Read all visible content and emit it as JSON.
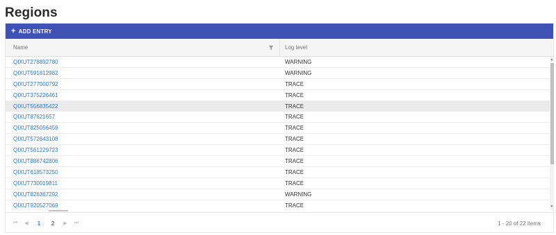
{
  "page": {
    "title": "Regions"
  },
  "toolbar": {
    "add_label": "ADD ENTRY"
  },
  "columns": {
    "name": "Name",
    "level": "Log level"
  },
  "rows": [
    {
      "name": "QIXUT278892780",
      "level": "WARNING"
    },
    {
      "name": "QIXUT591812982",
      "level": "WARNING"
    },
    {
      "name": "QIXUT277000792",
      "level": "TRACE"
    },
    {
      "name": "QIXUT375226461",
      "level": "TRACE"
    },
    {
      "name": "QIXUT556835422",
      "level": "TRACE"
    },
    {
      "name": "QIXUT87621657",
      "level": "TRACE"
    },
    {
      "name": "QIXUT825056459",
      "level": "TRACE"
    },
    {
      "name": "QIXUT572643108",
      "level": "TRACE"
    },
    {
      "name": "QIXUT561229723",
      "level": "TRACE"
    },
    {
      "name": "QIXUT886742806",
      "level": "TRACE"
    },
    {
      "name": "QIXUT618573250",
      "level": "TRACE"
    },
    {
      "name": "QIXUT730019811",
      "level": "TRACE"
    },
    {
      "name": "QIXUT826367292",
      "level": "WARNING"
    },
    {
      "name": "QIXUT920527069",
      "level": "TRACE"
    }
  ],
  "pager": {
    "pages": [
      "1",
      "2"
    ],
    "current": "1",
    "info": "1 - 20 of 22 items"
  },
  "colors": {
    "toolbar": "#3f51b5",
    "link": "#2e7bd6",
    "hover_row": "#ebebeb"
  }
}
